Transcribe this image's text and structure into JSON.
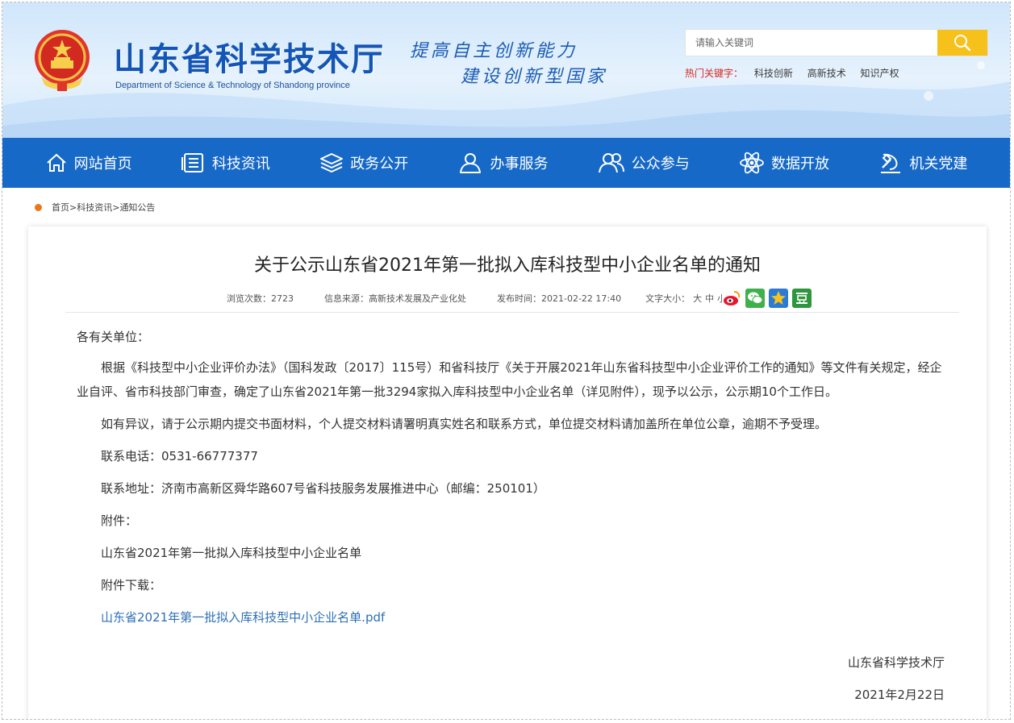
{
  "header": {
    "site_title": "山东省科学技术厅",
    "site_subtitle": "Department of Science & Technology of Shandong province",
    "slogan_line1": "提高自主创新能力",
    "slogan_line2": "建设创新型国家",
    "search": {
      "placeholder": "请输入关键词"
    },
    "hotwords": {
      "label": "热门关键字：",
      "items": [
        "科技创新",
        "高新技术",
        "知识产权"
      ]
    }
  },
  "nav": {
    "items": [
      {
        "label": "网站首页",
        "icon": "home-icon"
      },
      {
        "label": "科技资讯",
        "icon": "news-icon"
      },
      {
        "label": "政务公开",
        "icon": "layers-icon"
      },
      {
        "label": "办事服务",
        "icon": "user-service-icon"
      },
      {
        "label": "公众参与",
        "icon": "people-icon"
      },
      {
        "label": "数据开放",
        "icon": "atom-icon"
      },
      {
        "label": "机关党建",
        "icon": "party-icon"
      }
    ],
    "bg_color": "#1669c7"
  },
  "breadcrumb": {
    "items": [
      "首页",
      "科技资讯",
      "通知公告"
    ],
    "separator": ">"
  },
  "article": {
    "title": "关于公示山东省2021年第一批拟入库科技型中小企业名单的通知",
    "meta": {
      "views_label": "浏览次数：",
      "views": "2723",
      "source_label": "信息来源：",
      "source": "高新技术发展及产业化处",
      "date_label": "发布时间：",
      "date": "2021-02-22 17:40",
      "fontsize_label": "文字大小：",
      "fontsize_options": [
        "大",
        "中",
        "小"
      ]
    },
    "share_icons": [
      "weibo-icon",
      "wechat-icon",
      "qzone-icon",
      "douban-icon"
    ],
    "salutation": "各有关单位：",
    "para1": "根据《科技型中小企业评价办法》（国科发政〔2017〕115号）和省科技厅《关于开展2021年山东省科技型中小企业评价工作的通知》等文件有关规定，经企业自评、省市科技部门审查，确定了山东省2021年第一批3294家拟入库科技型中小企业名单（详见附件），现予以公示，公示期10个工作日。",
    "para2": "如有异议，请于公示期内提交书面材料，个人提交材料请署明真实姓名和联系方式，单位提交材料请加盖所在单位公章，逾期不予受理。",
    "phone_line": "联系电话：0531-66777377",
    "address_line": "联系地址：济南市高新区舜华路607号省科技服务发展推进中心（邮编：250101）",
    "attachment_label": "附件：",
    "attachment_name": "山东省2021年第一批拟入库科技型中小企业名单",
    "download_label": "附件下载：",
    "download_link": "山东省2021年第一批拟入库科技型中小企业名单.pdf",
    "signature": "山东省科学技术厅",
    "sign_date": "2021年2月22日"
  }
}
